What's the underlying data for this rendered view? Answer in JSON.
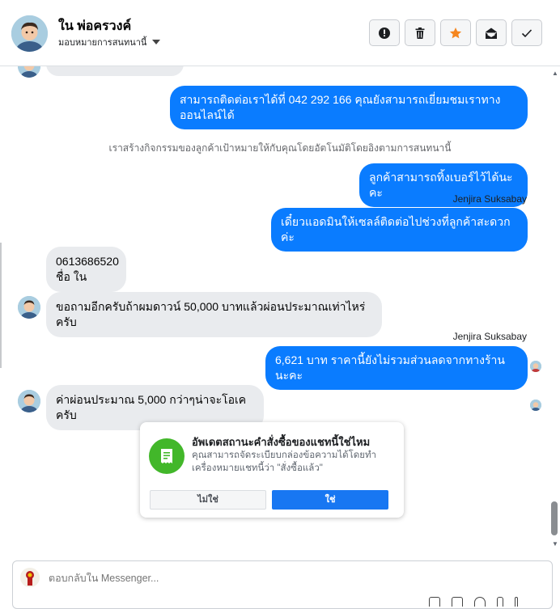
{
  "header": {
    "contact_name": "ใน พ่อครวงค์",
    "assign_label": "มอบหมายการสนทนานี้",
    "actions": [
      {
        "name": "report-icon"
      },
      {
        "name": "trash-icon"
      },
      {
        "name": "star-icon"
      },
      {
        "name": "mark-unread-icon"
      },
      {
        "name": "checkmark-icon"
      }
    ]
  },
  "thread": {
    "messages": [
      {
        "side": "out",
        "text_line1": "สามารถติดต่อเราได้ที่ 042 292 166 คุณยังสามารถเยี่ยมชมเราทาง",
        "text_line2": "ออนไลน์ได้"
      },
      {
        "side": "system",
        "text": "เราสร้างกิจกรรมของลูกค้าเป้าหมายให้กับคุณโดยอัตโนมัติโดยอิงตามการสนทนานี้"
      },
      {
        "side": "out",
        "text": "ลูกค้าสามารถทิ้งเบอร์ไว้ได้นะคะ"
      },
      {
        "side": "sender",
        "text": "Jenjira Suksabay"
      },
      {
        "side": "out",
        "text": "เดี๋ยวแอดมินให้เซลล์ติดต่อไปช่วงที่ลูกค้าสะดวกค่ะ"
      },
      {
        "side": "in",
        "text_line1": "0613686520",
        "text_line2": "ชื่อ  ใน"
      },
      {
        "side": "in",
        "text": "ขอถามอีกครับถ้าผมดาวน์ 50,000 บาทแล้วผ่อนประมาณเท่าไหร่ครับ"
      },
      {
        "side": "sender",
        "text": "Jenjira Suksabay"
      },
      {
        "side": "out",
        "text": "6,621 บาท ราคานี้ยังไม่รวมส่วนลดจากทางร้านนะคะ"
      },
      {
        "side": "in",
        "text": "ค่าผ่อนประมาณ 5,000 กว่าๆน่าจะโอเคครับ"
      }
    ]
  },
  "order_card": {
    "title": "อัพเดตสถานะคำสั่งซื้อของแชทนี้ใช่ไหม",
    "description": "คุณสามารถจัดระเบียบกล่องข้อความได้โดยทำเครื่องหมายแชทนี้ว่า \"สั่งซื้อแล้ว\"",
    "no_label": "ไม่ใช่",
    "yes_label": "ใช่"
  },
  "composer": {
    "placeholder": "ตอบกลับใน Messenger..."
  },
  "colors": {
    "outgoing_bubble": "#0a7cff",
    "incoming_bubble": "#e9ebee",
    "primary_button": "#1877f2",
    "card_icon": "#42b72a",
    "star": "#f5861f"
  }
}
